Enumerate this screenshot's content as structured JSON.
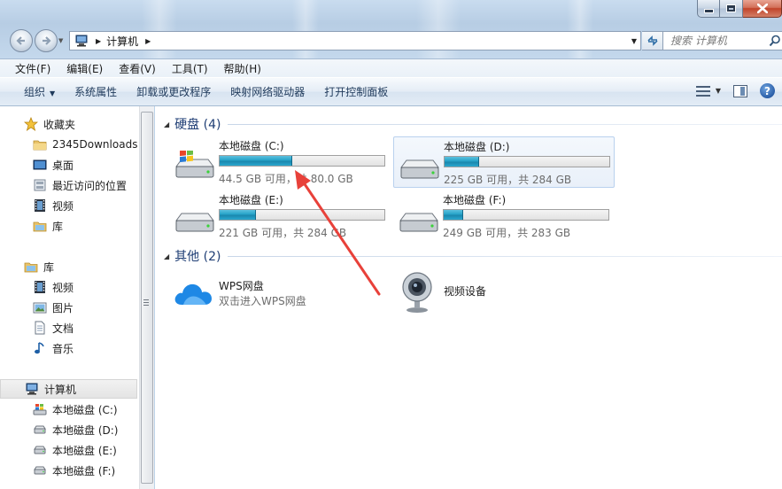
{
  "window": {
    "controls": {
      "minimize": "minimize",
      "maximize": "maximize",
      "close": "close"
    }
  },
  "address_bar": {
    "crumbs": [
      "计算机"
    ],
    "search_placeholder": "搜索 计算机"
  },
  "menu": [
    "文件(F)",
    "编辑(E)",
    "查看(V)",
    "工具(T)",
    "帮助(H)"
  ],
  "toolbar": {
    "organize": "组织",
    "buttons": [
      "系统属性",
      "卸载或更改程序",
      "映射网络驱动器",
      "打开控制面板"
    ]
  },
  "nav": {
    "favorites": {
      "label": "收藏夹",
      "items": [
        "2345Downloads",
        "桌面",
        "最近访问的位置",
        "视频",
        "库"
      ]
    },
    "libraries": {
      "label": "库",
      "items": [
        "视频",
        "图片",
        "文档",
        "音乐"
      ]
    },
    "computer": {
      "label": "计算机",
      "items": [
        "本地磁盘 (C:)",
        "本地磁盘 (D:)",
        "本地磁盘 (E:)",
        "本地磁盘 (F:)"
      ]
    }
  },
  "groups": {
    "disks": {
      "title": "硬盘 (4)",
      "drives": [
        {
          "name": "本地磁盘 (C:)",
          "free_text": "44.5 GB 可用，共 80.0 GB",
          "used_fraction": 0.44,
          "windows": true
        },
        {
          "name": "本地磁盘 (D:)",
          "free_text": "225 GB 可用，共 284 GB",
          "used_fraction": 0.21,
          "windows": false
        },
        {
          "name": "本地磁盘 (E:)",
          "free_text": "221 GB 可用，共 284 GB",
          "used_fraction": 0.22,
          "windows": false
        },
        {
          "name": "本地磁盘 (F:)",
          "free_text": "249 GB 可用，共 283 GB",
          "used_fraction": 0.12,
          "windows": false
        }
      ]
    },
    "other": {
      "title": "其他 (2)",
      "items": [
        {
          "name": "WPS网盘",
          "desc": "双击进入WPS网盘",
          "icon": "cloud-icon"
        },
        {
          "name": "视频设备",
          "desc": "",
          "icon": "webcam-icon"
        }
      ]
    }
  },
  "colors": {
    "bar_fill": "#25a2c8",
    "group_title": "#1e3d74",
    "annotation_arrow": "#e8413a",
    "selection_border": "#b9d1ee"
  }
}
